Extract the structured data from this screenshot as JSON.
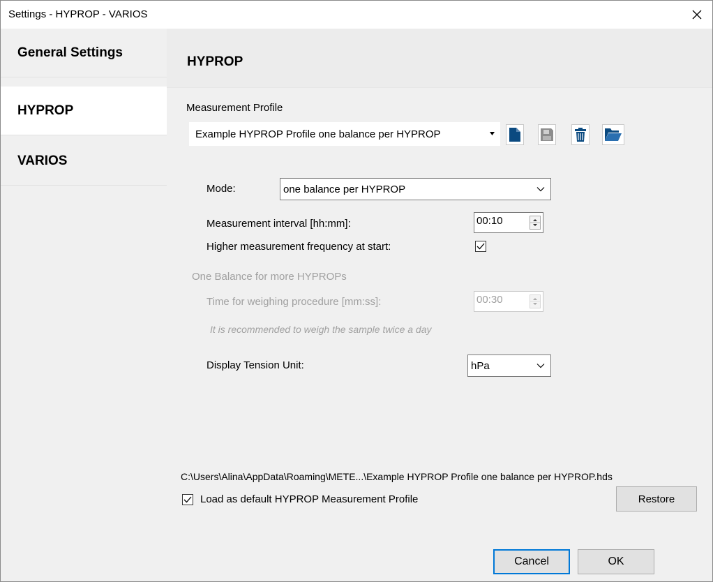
{
  "window": {
    "title": "Settings - HYPROP - VARIOS"
  },
  "sidebar": {
    "items": [
      {
        "label": "General Settings"
      },
      {
        "label": "HYPROP"
      },
      {
        "label": "VARIOS"
      }
    ]
  },
  "main": {
    "title": "HYPROP",
    "measurement_profile": {
      "label": "Measurement Profile",
      "selected": "Example HYPROP Profile one balance per HYPROP",
      "toolbar_icons": [
        "new-file-icon",
        "save-disk-icon",
        "trash-icon",
        "open-folder-icon"
      ]
    },
    "mode": {
      "label": "Mode:",
      "value": "one balance per HYPROP"
    },
    "interval": {
      "label": "Measurement interval [hh:mm]:",
      "value": "00:10"
    },
    "higher_frequency": {
      "label": "Higher measurement frequency at start:",
      "checked": true
    },
    "one_balance": {
      "group_label": "One Balance for more HYPROPs",
      "weighing_label": "Time for weighing procedure [mm:ss]:",
      "weighing_value": "00:30",
      "hint": "It is recommended to weigh the sample twice a day"
    },
    "tension_unit": {
      "label": "Display Tension Unit:",
      "value": "hPa"
    },
    "file_path": "C:\\Users\\Alina\\AppData\\Roaming\\METE...\\Example HYPROP Profile one balance per HYPROP.hds",
    "load_default": {
      "label": "Load as default HYPROP Measurement Profile",
      "checked": true
    },
    "restore_label": "Restore"
  },
  "footer": {
    "cancel_label": "Cancel",
    "ok_label": "OK"
  },
  "colors": {
    "accent": "#0078d7",
    "icon_blue": "#0b4a80",
    "icon_disabled": "#8c8c8c",
    "disabled_text": "#a0a0a0"
  }
}
